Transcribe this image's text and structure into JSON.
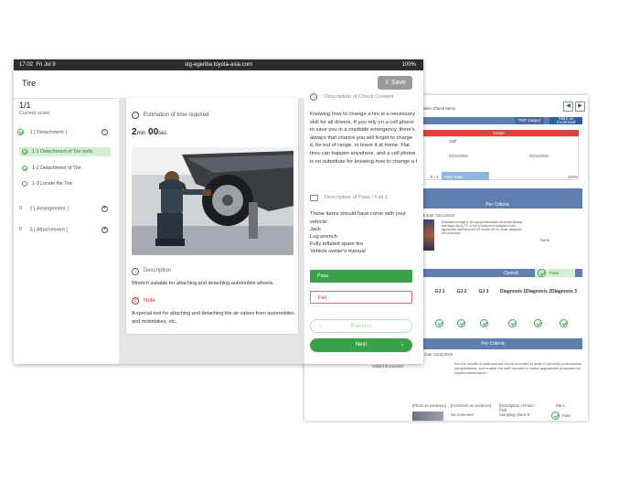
{
  "report": {
    "title": "Evaluation Check Items",
    "nav_prev": "◀",
    "nav_next": "▶",
    "pdf_button": "PDF Output",
    "confirm_button": "Mark as Confirmed",
    "grade_header": "Grade",
    "detail_rows": [
      "Staff",
      "02/11/2020",
      "02/11/2020",
      "0 / 4",
      "Pass Ratio",
      "100%"
    ],
    "per_criteria_1": "Per Criteria",
    "check_date_1": "Check date: 02/11/2020",
    "small_text": "[Simulation] Image to be appropriate related personnel tasking and diagnosis by TS. Is the IQ instrument assigned to the appropriate staff/personnel for handle the fix, repair, diagnosis with accuracy?",
    "none_label": "None",
    "overall_label": "Overall",
    "overall_status": "Pass",
    "score_headers": [
      "GJ 1",
      "GJ 2",
      "GJ 3",
      "Diagnosis 1",
      "Diagnosis 2",
      "Diagnosis 3"
    ],
    "per_criteria_2": "Per Criteria",
    "check_date_2": "Check date: 02/11/2020",
    "question": "Are the results of walk-around check recorded in order to prevent unnecessary complications, and enable the staff member to make appropriate proposals for repair/maintenance?",
    "related_docs": "related documents",
    "table_headers": [
      "[Photo as evidence]",
      "[Comment as evidence]",
      "[Description of Pass / Fail]",
      "PM 1"
    ],
    "no_comment": "No Comment",
    "sampling": "Sampling check 9",
    "bottom_pass": "Pass"
  },
  "tablet": {
    "status": {
      "time": "17:02",
      "date": "Fri Jul 9",
      "url": "stg-egeriba.toyota-asia.com",
      "battery": "100%"
    },
    "title": "Tire",
    "save_label": "Save",
    "score": "1/1",
    "score_label": "Current score",
    "tree": [
      {
        "label": "1 [ Detachment ]",
        "expanded": true,
        "children": [
          "1-1 Detachment of Tire bolts",
          "1-2 Detachment of Tire",
          "1-3 Locate the Tire"
        ]
      },
      {
        "label": "2 [ Arrangement ]",
        "expanded": false
      },
      {
        "label": "3 [ Attachement ]",
        "expanded": false
      }
    ],
    "estimation_label": "Estimation of time required",
    "estimation_min": "2",
    "estimation_min_unit": "min",
    "estimation_sec": "00",
    "estimation_sec_unit": "sec",
    "description_label": "Description",
    "description_text": "Wrench suitable for attaching and detaching automobile wheels.",
    "note_label": "Note",
    "note_text": "A special tool for attaching and detaching tire air valves from automobiles and motorbikes, etc.",
    "check_content_label": "Description of Check Content",
    "check_content_text": "Knowing how to change a tire is a necessary skill for all drivers. If you rely on a cell phone to save you in a roadside emergency, there's always that chance you will forget to charge it, be out of range, or leave it at home. Flat tires can happen anywhere, and a cell phone is no substitute for knowing how to change a f",
    "passfail_label": "Description of Pass / Fail 1",
    "passfail_text": "These items should have come with your vehicle:",
    "passfail_items": [
      "Jack",
      "Lug wrench",
      "Fully inflated spare tire",
      "Vehicle owner's manual"
    ],
    "pass_option": "Pass",
    "fail_option": "Fail",
    "previous_label": "Previous",
    "next_label": "Next"
  }
}
